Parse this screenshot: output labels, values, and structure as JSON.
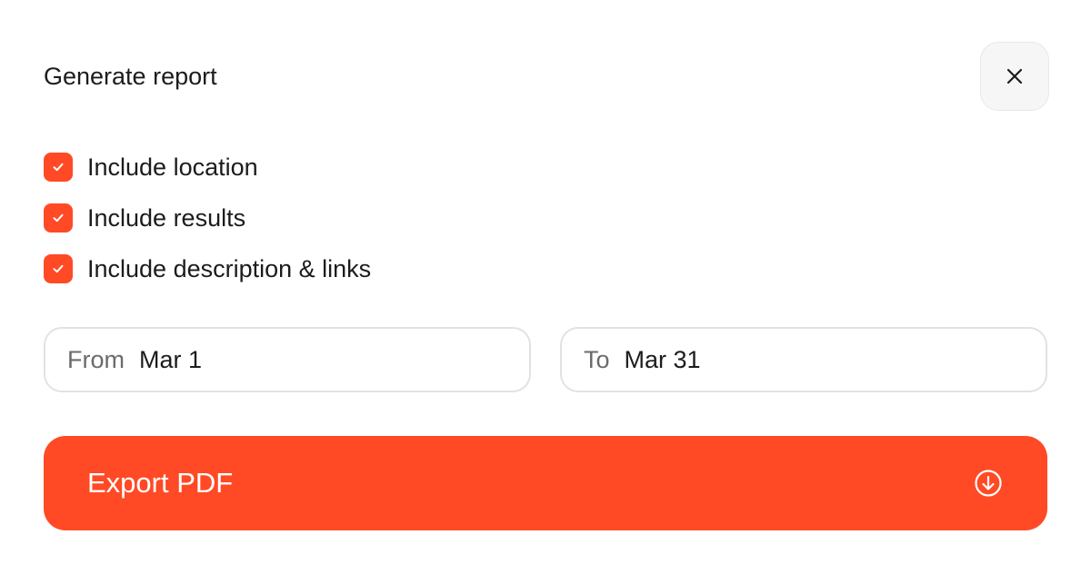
{
  "dialog": {
    "title": "Generate report",
    "close_icon": "close-icon"
  },
  "options": [
    {
      "label": "Include location",
      "checked": true
    },
    {
      "label": "Include results",
      "checked": true
    },
    {
      "label": "Include description & links",
      "checked": true
    }
  ],
  "date_range": {
    "from_prefix": "From",
    "from_value": "Mar 1",
    "to_prefix": "To",
    "to_value": "Mar 31"
  },
  "export": {
    "label": "Export PDF",
    "icon": "download-circle-icon"
  },
  "colors": {
    "accent": "#ff4a25",
    "border": "#e2e2e2",
    "close_bg": "#f6f6f6"
  }
}
